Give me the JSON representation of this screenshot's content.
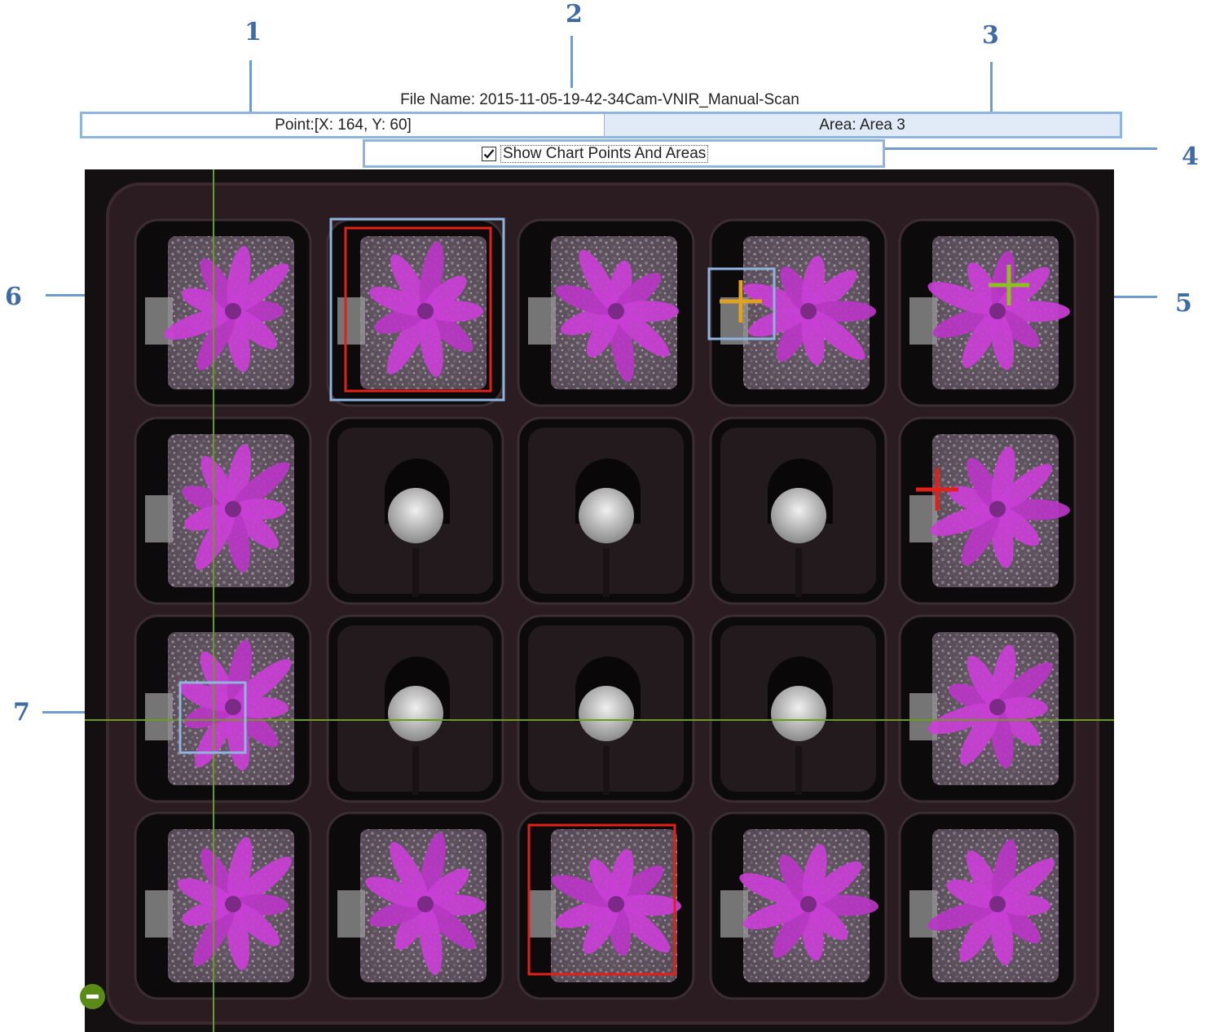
{
  "header": {
    "file_name": "File Name: 2015-11-05-19-42-34Cam-VNIR_Manual-Scan"
  },
  "status": {
    "point": "Point:[X: 164, Y: 60]",
    "area": "Area: Area 3"
  },
  "toggle": {
    "label": "Show Chart Points And Areas",
    "checked": true
  },
  "callouts": [
    "1",
    "2",
    "3",
    "4",
    "5",
    "6",
    "7"
  ],
  "markers": [
    {
      "name": "point-marker-orange",
      "color": "#e0a21e"
    },
    {
      "name": "point-marker-green",
      "color": "#8cc21c"
    },
    {
      "name": "point-marker-red",
      "color": "#e0201a"
    }
  ],
  "areas": [
    {
      "name": "area-rectangle-top",
      "color": "#e0201a"
    },
    {
      "name": "area-rectangle-bottom",
      "color": "#e0201a"
    }
  ],
  "crosshair_color": "#6c9a20",
  "zoom_control": {
    "icon": "zoom-out-icon",
    "color": "#5a8a18"
  }
}
